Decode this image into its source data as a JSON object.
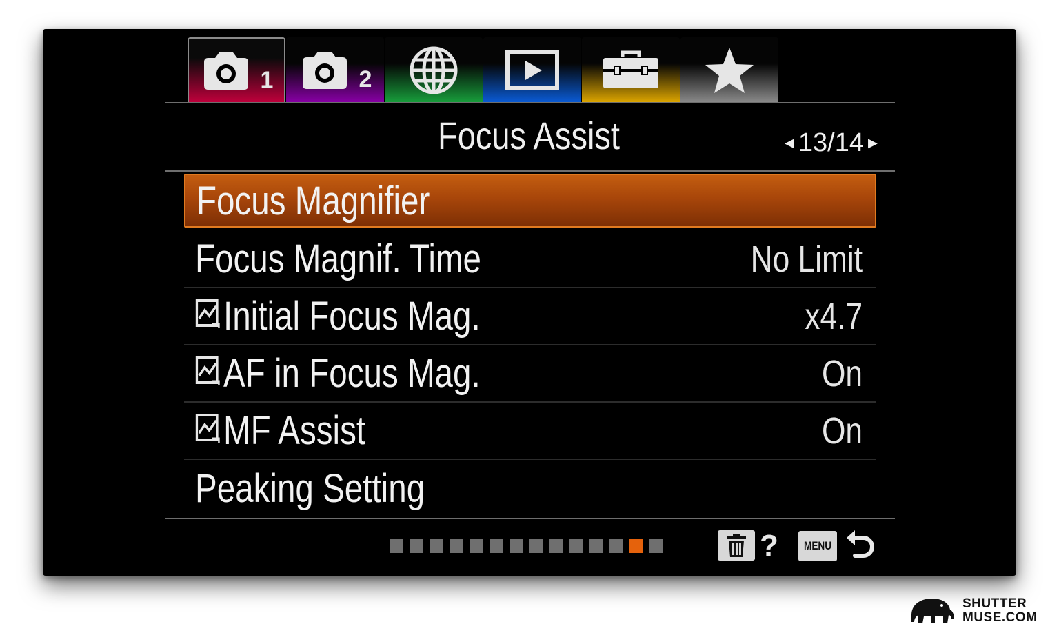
{
  "tabs": [
    {
      "name": "camera-settings-1",
      "icon": "camera-icon",
      "badge": "1",
      "color": "#c2003c",
      "active": true
    },
    {
      "name": "camera-settings-2",
      "icon": "camera-icon",
      "badge": "2",
      "color": "#8a00a8",
      "active": false
    },
    {
      "name": "network",
      "icon": "globe-icon",
      "badge": "",
      "color": "#18a03c",
      "active": false
    },
    {
      "name": "playback",
      "icon": "playback-icon",
      "badge": "",
      "color": "#0a5cd8",
      "active": false
    },
    {
      "name": "setup",
      "icon": "toolbox-icon",
      "badge": "",
      "color": "#e0a800",
      "active": false
    },
    {
      "name": "my-menu",
      "icon": "star-icon",
      "badge": "",
      "color": "#8c8c8c",
      "active": false
    }
  ],
  "header": {
    "title": "Focus Assist",
    "page_current": "13",
    "page_sep": "/",
    "page_total": "14"
  },
  "menu": {
    "items": [
      {
        "label": "Focus Magnifier",
        "value": "",
        "still_icon": false,
        "selected": true
      },
      {
        "label": "Focus Magnif. Time",
        "value": "No Limit",
        "still_icon": false,
        "selected": false
      },
      {
        "label": "Initial Focus Mag.",
        "value": "x4.7",
        "still_icon": true,
        "selected": false
      },
      {
        "label": "AF in Focus Mag.",
        "value": "On",
        "still_icon": true,
        "selected": false
      },
      {
        "label": "MF Assist",
        "value": "On",
        "still_icon": true,
        "selected": false
      },
      {
        "label": "Peaking Setting",
        "value": "",
        "still_icon": false,
        "selected": false
      }
    ]
  },
  "page_indicator": {
    "total": 14,
    "current": 13
  },
  "footer": {
    "delete_icon": "trash-icon",
    "help_label": "?",
    "menu_label": "MENU",
    "back_icon": "return-icon"
  },
  "watermark": {
    "line1": "SHUTTER",
    "line2": "MUSE.COM",
    "icon": "elephant-icon"
  },
  "colors": {
    "selected_row": "#b4500c",
    "active_dot": "#e5620c",
    "inactive_dot": "#6f6f6f"
  }
}
